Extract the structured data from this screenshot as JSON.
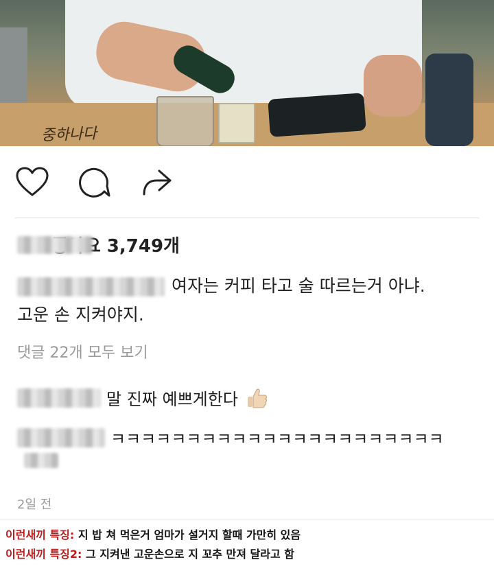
{
  "photo": {
    "handwriting": "중하나다"
  },
  "post": {
    "likes_label": "좋아요 3,749개",
    "caption_text": "여자는 커피 타고 술 따르는거 아냐.",
    "caption_line2": "고운 손 지켜야지.",
    "view_all_comments": "댓글 22개 모두 보기",
    "comments": [
      {
        "text": "말 진짜 예쁘게한다"
      },
      {
        "text": "ㅋㅋㅋㅋㅋㅋㅋㅋㅋㅋㅋㅋㅋㅋㅋㅋㅋㅋㅋㅋㅋㅋ"
      }
    ],
    "time_ago": "2일 전"
  },
  "icons": {
    "like": "heart-icon",
    "comment": "comment-bubble-icon",
    "share": "share-arrow-icon",
    "thumbs_up": "thumbs-up-emoji"
  },
  "notes": [
    {
      "label": "이런새끼 특징:",
      "text": "지 밥 쳐 먹은거 엄마가 설거지 할때 가만히 있음"
    },
    {
      "label": "이런새끼 특징2:",
      "text": "그 지켜낸 고운손으로 지 꼬추 만져 달라고 함"
    }
  ],
  "colors": {
    "note_label": "#c21a1a",
    "muted_text": "#9a9a9a"
  }
}
